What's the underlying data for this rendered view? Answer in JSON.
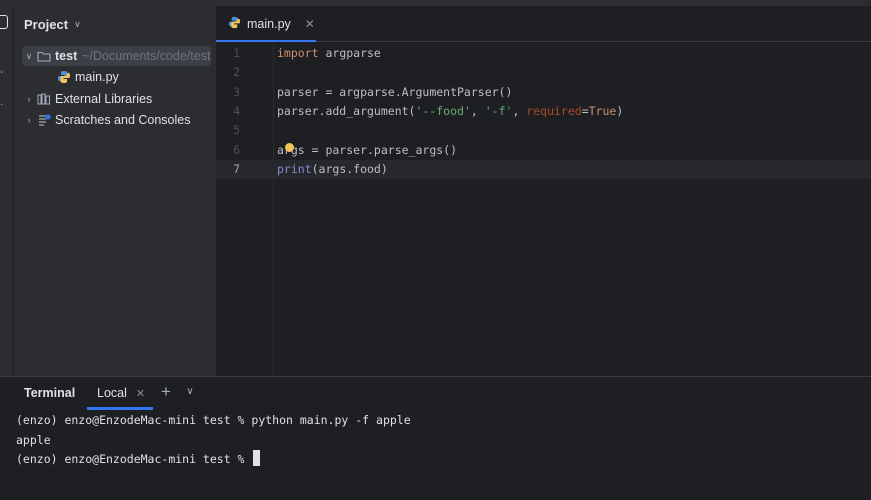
{
  "project": {
    "title": "Project",
    "tree": [
      {
        "label": "test",
        "hint": "~/Documents/code/test"
      },
      {
        "label": "main.py"
      },
      {
        "label": "External Libraries"
      },
      {
        "label": "Scratches and Consoles"
      }
    ]
  },
  "editor": {
    "tab_label": "main.py",
    "lines": [
      {
        "num": "1"
      },
      {
        "num": "2"
      },
      {
        "num": "3"
      },
      {
        "num": "4"
      },
      {
        "num": "5"
      },
      {
        "num": "6"
      },
      {
        "num": "7"
      }
    ],
    "code": {
      "l1_kw": "import",
      "l1_rest": " argparse",
      "l3": "parser = argparse.ArgumentParser()",
      "l4_a": "parser.add_argument(",
      "l4_s1": "'--food'",
      "l4_c1": ", ",
      "l4_s2": "'-f'",
      "l4_c2": ", ",
      "l4_param": "required",
      "l4_eq": "=",
      "l4_bool": "True",
      "l4_end": ")",
      "l6": "args = parser.parse_args()",
      "l7_fn": "print",
      "l7_rest": "(args.food)"
    }
  },
  "terminal": {
    "title": "Terminal",
    "tab_label": "Local",
    "lines": [
      "(enzo) enzo@EnzodeMac-mini test % python main.py -f apple",
      "apple",
      "(enzo) enzo@EnzodeMac-mini test % "
    ]
  },
  "colors": {
    "accent": "#3574f0",
    "keyword": "#cf8e6d",
    "string": "#6aab73",
    "param": "#aa4926",
    "builtin": "#8888c6"
  },
  "icons": {
    "folder": "folder-icon",
    "python_file": "python-file-icon",
    "library": "library-icon",
    "scratches": "scratches-icon",
    "bulb": "intention-bulb-icon"
  }
}
